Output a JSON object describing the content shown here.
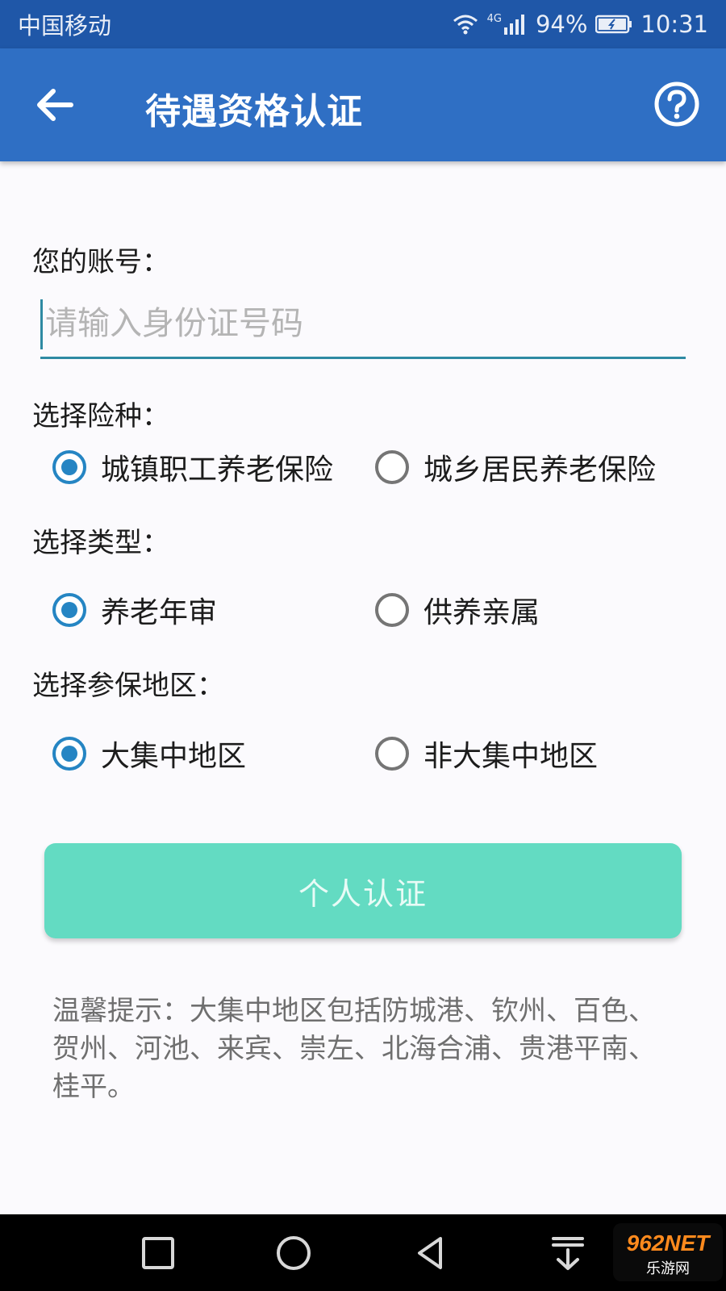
{
  "status_bar": {
    "carrier": "中国移动",
    "network": "4G",
    "battery": "94%",
    "time": "10:31",
    "icons": [
      "wifi-icon",
      "signal-icon",
      "battery-icon"
    ]
  },
  "app_bar": {
    "title": "待遇资格认证",
    "back_icon": "arrow-left-icon",
    "help_icon": "question-circle-icon"
  },
  "form": {
    "account_label": "您的账号：",
    "account_placeholder": "请输入身份证号码",
    "account_value": "",
    "insurance": {
      "label": "选择险种：",
      "options": [
        "城镇职工养老保险",
        "城乡居民养老保险"
      ],
      "selected": 0
    },
    "type": {
      "label": "选择类型：",
      "options": [
        "养老年审",
        "供养亲属"
      ],
      "selected": 0
    },
    "region": {
      "label": "选择参保地区：",
      "options": [
        "大集中地区",
        "非大集中地区"
      ],
      "selected": 0
    },
    "submit_label": "个人认证",
    "tip": "温馨提示：大集中地区包括防城港、钦州、百色、贺州、河池、来宾、崇左、北海合浦、贵港平南、桂平。"
  },
  "nav_bar": {
    "icons": [
      "recent-apps-icon",
      "home-icon",
      "back-triangle-icon",
      "notification-pull-icon"
    ]
  },
  "watermark": {
    "brand": "962NET",
    "subtitle": "乐游网"
  },
  "colors": {
    "status_bar": "#1f57a8",
    "app_bar": "#2f6fc4",
    "accent": "#2585c3",
    "input_underline": "#2e8aa3",
    "button": "#63dbc2"
  }
}
